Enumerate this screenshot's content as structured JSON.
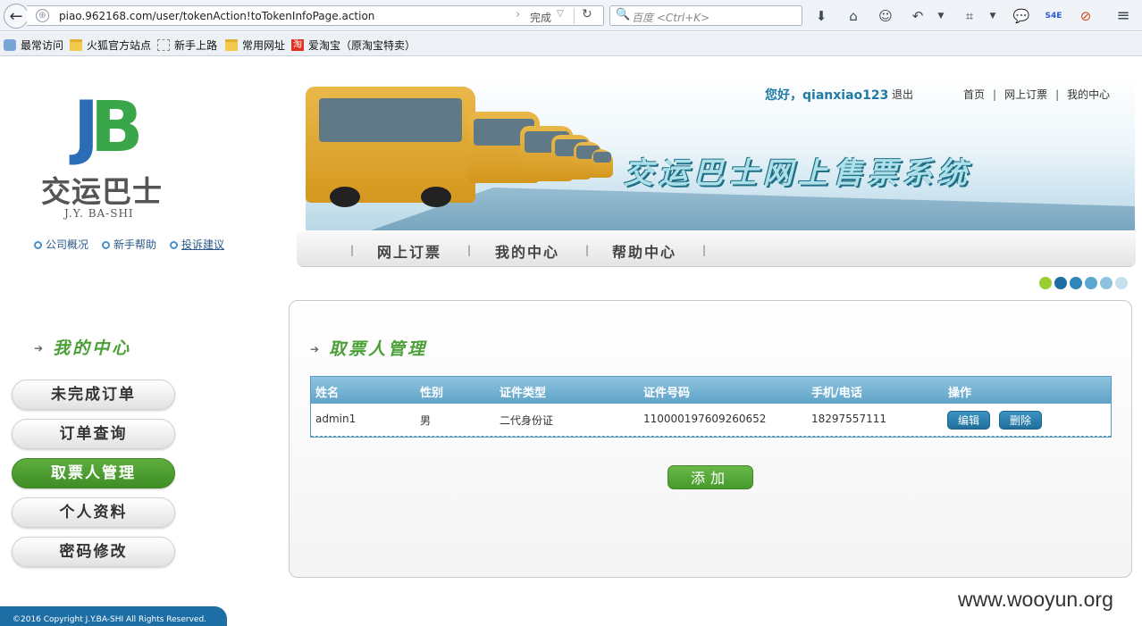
{
  "browser": {
    "url": "piao.962168.com/user/tokenAction!toTokenInfoPage.action",
    "status": "完成",
    "search_placeholder": "百度 <Ctrl+K>",
    "bookmarks": [
      "最常访问",
      "火狐官方站点",
      "新手上路",
      "常用网址",
      "爱淘宝（原淘宝特卖）"
    ],
    "toolbar_icons": [
      "download-icon",
      "home-icon",
      "chat-icon",
      "undo-icon",
      "crop-icon",
      "message-icon",
      "s4e-icon",
      "adblock-icon",
      "menu-icon"
    ]
  },
  "logo": {
    "mark_j": "J",
    "mark_b": "B",
    "cn": "交运巴士",
    "en": "J.Y. BA-SHI"
  },
  "top_links": [
    "公司概况",
    "新手帮助",
    "投诉建议"
  ],
  "header": {
    "greeting": "您好，qianxiao123",
    "logout": "退出",
    "right_links": [
      "首页",
      "网上订票",
      "我的中心"
    ],
    "banner_title": "交运巴士网上售票系统"
  },
  "main_nav": [
    "网上订票",
    "我的中心",
    "帮助中心"
  ],
  "theme_dots": [
    "#9acd32",
    "#1e6ea6",
    "#2f86b8",
    "#5aa6cf",
    "#8ec3df",
    "#c6e1ee"
  ],
  "sidebar": {
    "title": "我的中心",
    "items": [
      "未完成订单",
      "订单查询",
      "取票人管理",
      "个人资料",
      "密码修改"
    ],
    "active": "取票人管理"
  },
  "content": {
    "title": "取票人管理",
    "columns": [
      "姓名",
      "性别",
      "证件类型",
      "证件号码",
      "手机/电话",
      "操作"
    ],
    "rows": [
      {
        "name": "admin1",
        "gender": "男",
        "id_type": "二代身份证",
        "id_number": "110000197609260652",
        "phone": "18297557111",
        "edit": "编辑",
        "delete": "删除"
      }
    ],
    "add_button": "添加"
  },
  "footer": "©2016 Copyright J.Y.BA-SHI All Rights Reserved.",
  "watermark": "www.wooyun.org"
}
